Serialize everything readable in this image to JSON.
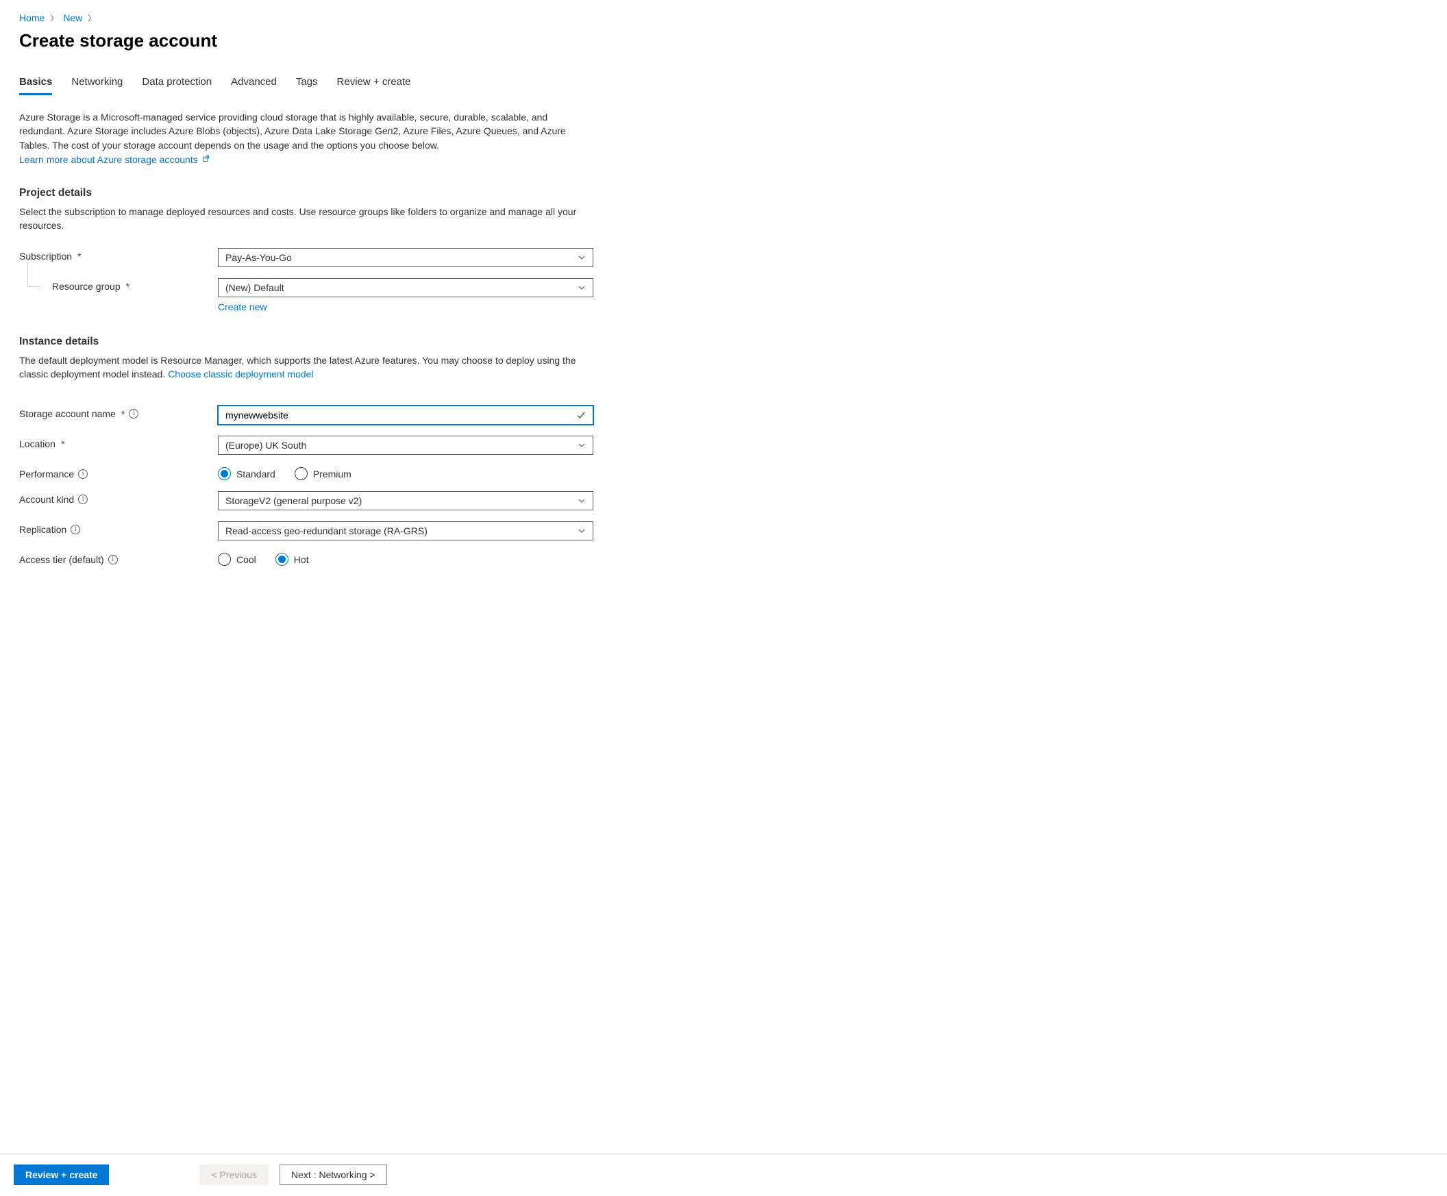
{
  "breadcrumb": {
    "items": [
      {
        "label": "Home"
      },
      {
        "label": "New"
      }
    ]
  },
  "title": "Create storage account",
  "tabs": [
    {
      "label": "Basics",
      "active": true
    },
    {
      "label": "Networking"
    },
    {
      "label": "Data protection"
    },
    {
      "label": "Advanced"
    },
    {
      "label": "Tags"
    },
    {
      "label": "Review + create"
    }
  ],
  "intro": {
    "text": "Azure Storage is a Microsoft-managed service providing cloud storage that is highly available, secure, durable, scalable, and redundant. Azure Storage includes Azure Blobs (objects), Azure Data Lake Storage Gen2, Azure Files, Azure Queues, and Azure Tables. The cost of your storage account depends on the usage and the options you choose below.",
    "link_label": "Learn more about Azure storage accounts"
  },
  "project": {
    "heading": "Project details",
    "help": "Select the subscription to manage deployed resources and costs. Use resource groups like folders to organize and manage all your resources.",
    "subscription_label": "Subscription",
    "subscription_value": "Pay-As-You-Go",
    "rg_label": "Resource group",
    "rg_value": "(New) Default",
    "rg_create": "Create new"
  },
  "instance": {
    "heading": "Instance details",
    "help_prefix": "The default deployment model is Resource Manager, which supports the latest Azure features. You may choose to deploy using the classic deployment model instead.  ",
    "classic_link": "Choose classic deployment model",
    "name_label": "Storage account name",
    "name_value": "mynewwebsite",
    "location_label": "Location",
    "location_value": "(Europe) UK South",
    "performance_label": "Performance",
    "performance_options": {
      "standard": "Standard",
      "premium": "Premium"
    },
    "kind_label": "Account kind",
    "kind_value": "StorageV2 (general purpose v2)",
    "replication_label": "Replication",
    "replication_value": "Read-access geo-redundant storage (RA-GRS)",
    "tier_label": "Access tier (default)",
    "tier_options": {
      "cool": "Cool",
      "hot": "Hot"
    }
  },
  "footer": {
    "review": "Review + create",
    "previous": "< Previous",
    "next": "Next : Networking >"
  }
}
